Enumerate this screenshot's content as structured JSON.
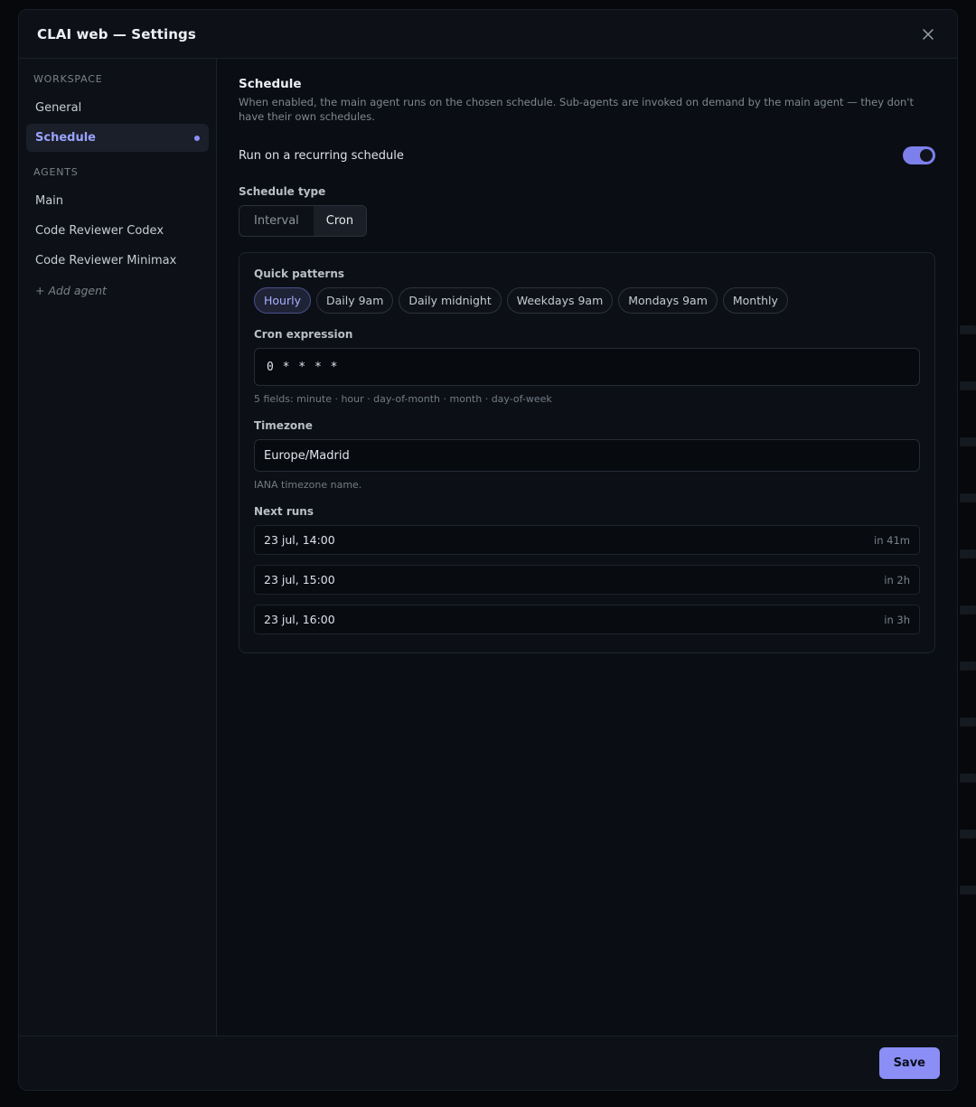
{
  "modal": {
    "title": "CLAI web — Settings"
  },
  "sidebar": {
    "workspace_heading": "WORKSPACE",
    "workspace_items": [
      {
        "label": "General"
      },
      {
        "label": "Schedule",
        "active": true
      }
    ],
    "agents_heading": "AGENTS",
    "agent_items": [
      {
        "label": "Main"
      },
      {
        "label": "Code Reviewer Codex"
      },
      {
        "label": "Code Reviewer Minimax"
      }
    ],
    "add_agent_label": "+ Add agent"
  },
  "schedule": {
    "title": "Schedule",
    "description": "When enabled, the main agent runs on the chosen schedule. Sub-agents are invoked on demand by the main agent — they don't have their own schedules.",
    "toggle_label": "Run on a recurring schedule",
    "toggle_on": true,
    "type_label": "Schedule type",
    "type_options": [
      "Interval",
      "Cron"
    ],
    "type_selected": "Cron",
    "quick_patterns_label": "Quick patterns",
    "quick_patterns": [
      "Hourly",
      "Daily 9am",
      "Daily midnight",
      "Weekdays 9am",
      "Mondays 9am",
      "Monthly"
    ],
    "quick_pattern_selected": "Hourly",
    "cron_label": "Cron expression",
    "cron_value": "0 * * * *",
    "cron_hint": "5 fields: minute · hour · day-of-month · month · day-of-week",
    "timezone_label": "Timezone",
    "timezone_value": "Europe/Madrid",
    "timezone_hint": "IANA timezone name.",
    "next_runs_label": "Next runs",
    "next_runs": [
      {
        "date": "23 jul, 14:00",
        "relative": "in 41m"
      },
      {
        "date": "23 jul, 15:00",
        "relative": "in 2h"
      },
      {
        "date": "23 jul, 16:00",
        "relative": "in 3h"
      }
    ]
  },
  "footer": {
    "save_label": "Save"
  },
  "colors": {
    "accent": "#8a8ef5",
    "background": "#0a0e14"
  },
  "icons": {
    "close": "close-icon"
  }
}
